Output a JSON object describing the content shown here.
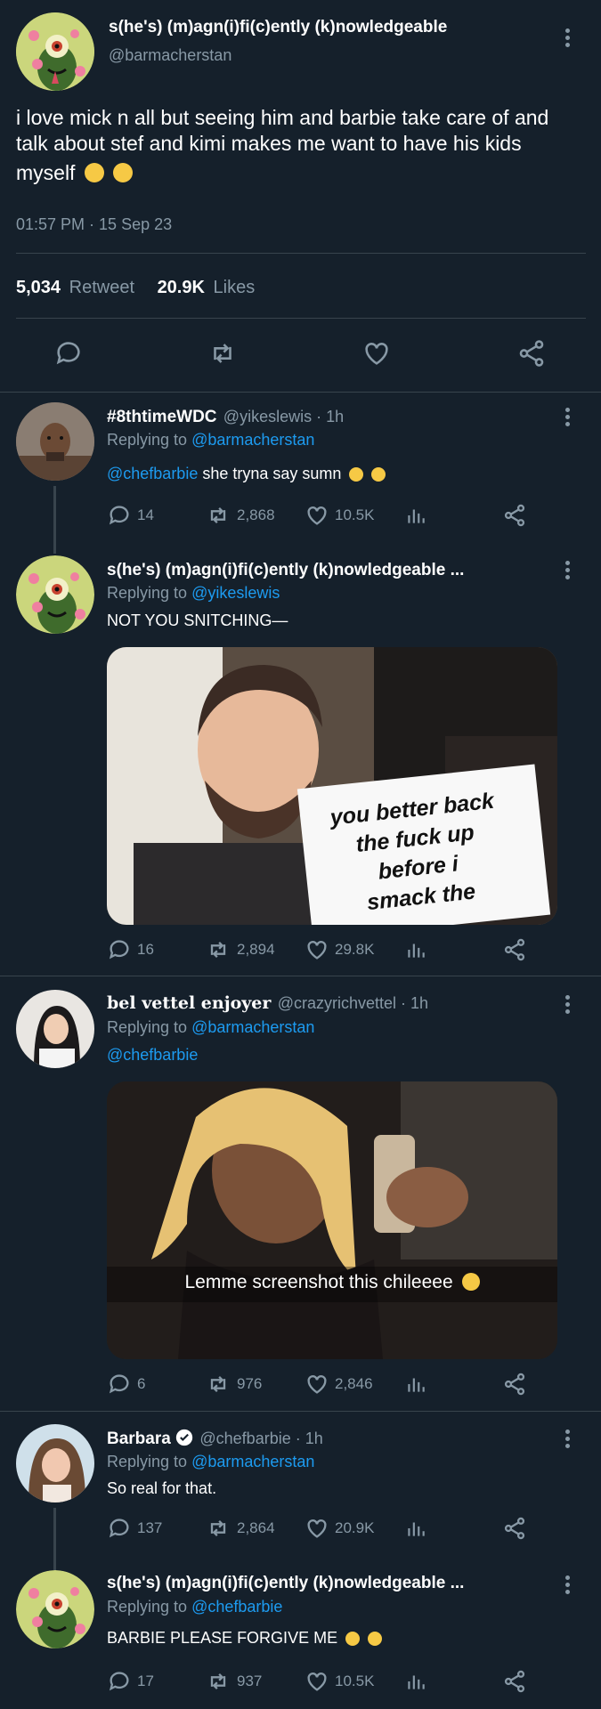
{
  "main_tweet": {
    "display_name": "s(he's) (m)agn(i)fi(c)ently (k)nowledgeable",
    "handle": "@barmacherstan",
    "text_line1": "i love mick n all but seeing him and barbie take care of and",
    "text_line2": "talk about stef and kimi makes me want to have his kids",
    "text_line3": "myself",
    "time": "01:57 PM · 15 Sep 23",
    "retweets_count": "5,034",
    "retweets_label": "Retweet",
    "likes_count": "20.9K",
    "likes_label": "Likes"
  },
  "replies": [
    {
      "display_name": "#8thtimeWDC",
      "handle": "@yikeslewis · 1h",
      "replying_prefix": "Replying to",
      "replying_to": "@barmacherstan",
      "mention": "@chefbarbie",
      "text": " she tryna say sumn",
      "comments": "14",
      "retweets": "2,868",
      "likes": "10.5K"
    },
    {
      "display_name": "s(he's) (m)agn(i)fi(c)ently (k)nowledgeable ...",
      "replying_prefix": "Replying to",
      "replying_to": "@yikeslewis",
      "text": "NOT YOU SNITCHING—",
      "image_sign_text_line1": "you better back",
      "image_sign_text_line2": "the fuck up",
      "image_sign_text_line3": "before i",
      "image_sign_text_line4": "smack the",
      "comments": "16",
      "retweets": "2,894",
      "likes": "29.8K"
    },
    {
      "display_name": "bel vettel enjoyer",
      "handle": "@crazyrichvettel · 1h",
      "replying_prefix": "Replying to",
      "replying_to": "@barmacherstan",
      "mention": "@chefbarbie",
      "image_caption": "Lemme screenshot this chileeee",
      "comments": "6",
      "retweets": "976",
      "likes": "2,846"
    },
    {
      "display_name": "Barbara",
      "handle": "@chefbarbie · 1h",
      "replying_prefix": "Replying to",
      "replying_to": "@barmacherstan",
      "text": "So real for that.",
      "comments": "137",
      "retweets": "2,864",
      "likes": "20.9K"
    },
    {
      "display_name": "s(he's) (m)agn(i)fi(c)ently (k)nowledgeable ...",
      "replying_prefix": "Replying to",
      "replying_to": "@chefbarbie",
      "text": "BARBIE PLEASE FORGIVE ME",
      "comments": "17",
      "retweets": "937",
      "likes": "10.5K"
    }
  ],
  "icons": [
    "reply-icon",
    "retweet-icon",
    "like-icon",
    "share-icon",
    "analytics-icon",
    "more-icon",
    "verified-icon"
  ],
  "colors": {
    "background": "#15202b",
    "link": "#1d9bf0",
    "secondary": "#8899a6",
    "divider": "#38444d"
  }
}
